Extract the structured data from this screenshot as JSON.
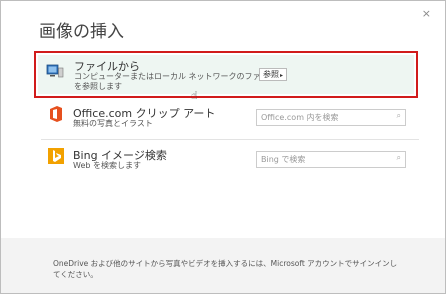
{
  "dialog": {
    "title": "画像の挿入",
    "close_label": "×"
  },
  "options": [
    {
      "title": "ファイルから",
      "description": "コンピューターまたはローカル ネットワークのファイルを参照します",
      "action_label": "参照",
      "icon": "computer-icon",
      "selected": true
    },
    {
      "title": "Office.com クリップ アート",
      "description": "無料の写真とイラスト",
      "search_placeholder": "Office.com 内を検索",
      "icon": "office-icon"
    },
    {
      "title": "Bing イメージ検索",
      "description": "Web を検索します",
      "search_placeholder": "Bing で検索",
      "icon": "bing-icon"
    }
  ],
  "footer": {
    "text": "OneDrive および他のサイトから写真やビデオを挿入するには、Microsoft アカウントでサインインしてください。"
  },
  "colors": {
    "selection_border": "#d11b1b",
    "office_icon": "#e6501e",
    "bing_icon": "#f2a100",
    "footer_bg": "#f3f3f3"
  }
}
